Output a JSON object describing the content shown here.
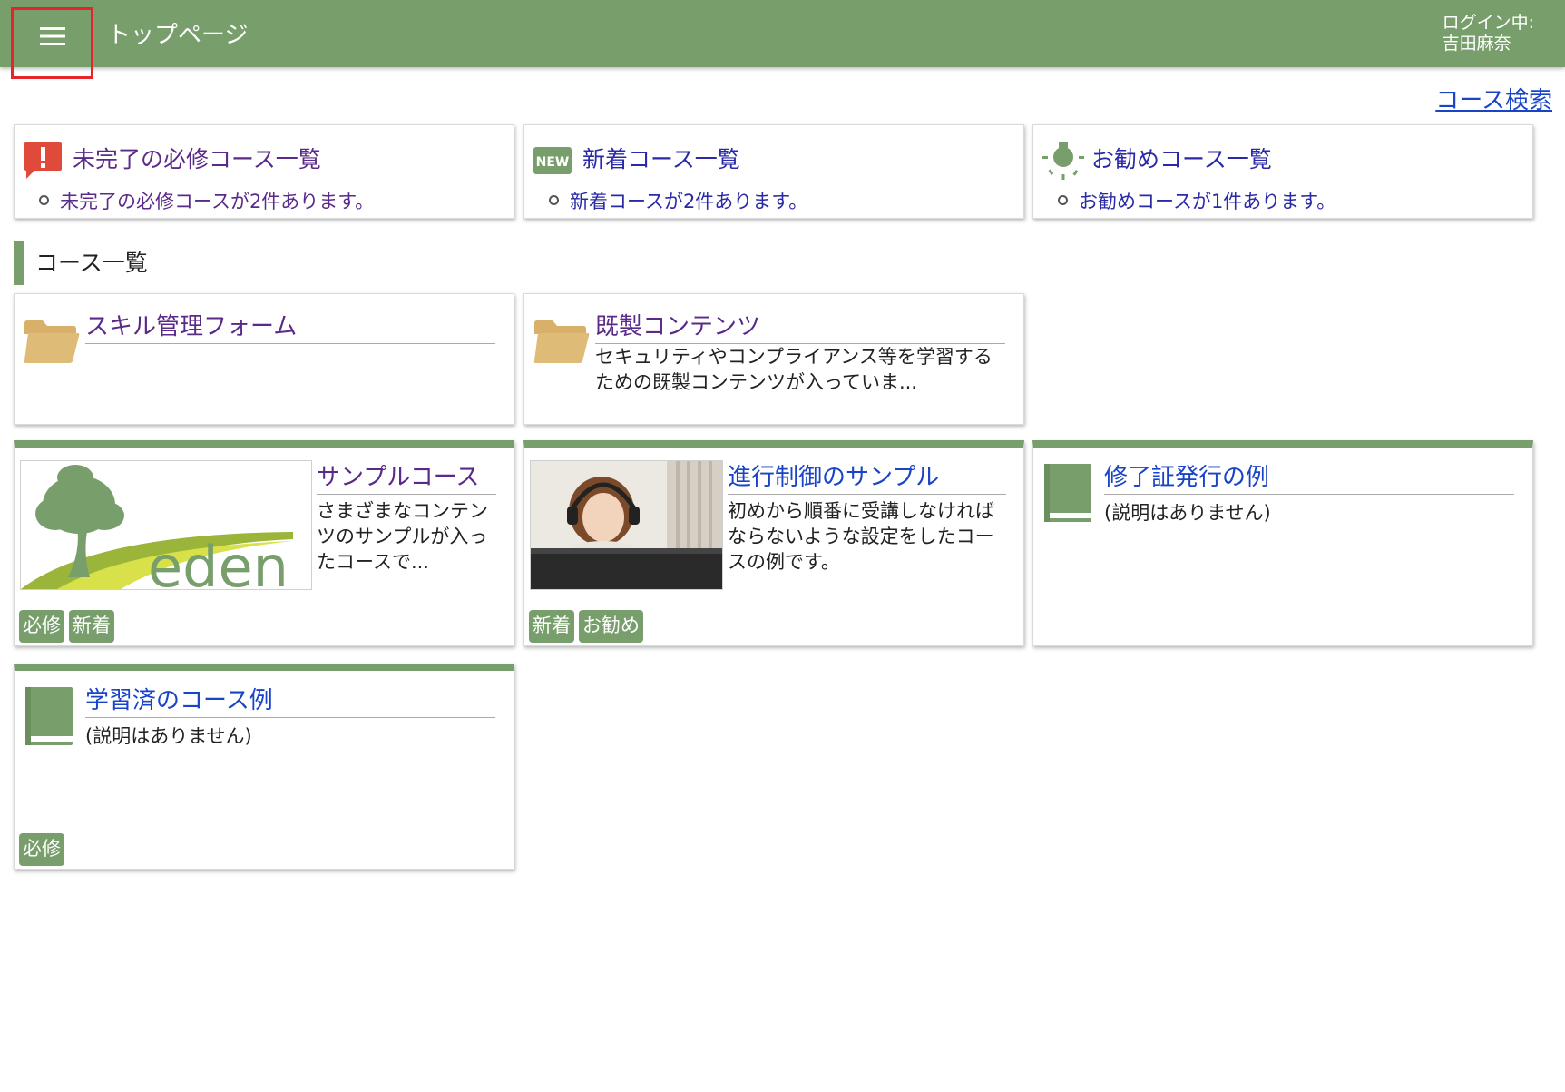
{
  "header": {
    "page_title": "トップページ",
    "login_label": "ログイン中:",
    "user_name": "吉田麻奈",
    "menu_icon": "hamburger-icon"
  },
  "course_search_label": "コース検索",
  "summaries": [
    {
      "title": "未完了の必修コース一覧",
      "item": "未完了の必修コースが2件あります。",
      "icon": "alert-icon"
    },
    {
      "title": "新着コース一覧",
      "item": "新着コースが2件あります。",
      "icon": "new-badge-icon"
    },
    {
      "title": "お勧めコース一覧",
      "item": "お勧めコースが1件あります。",
      "icon": "lightbulb-icon"
    }
  ],
  "section_title": "コース一覧",
  "folders": [
    {
      "title": "スキル管理フォーム",
      "description": "",
      "icon": "folder-icon"
    },
    {
      "title": "既製コンテンツ",
      "description": "セキュリティやコンプライアンス等を学習するための既製コンテンツが入っていま...",
      "icon": "folder-icon"
    }
  ],
  "courses": [
    {
      "title": "サンプルコース",
      "description": "さまざまなコンテンツのサンプルが入ったコースで...",
      "thumbnail_text": "eden",
      "tags": [
        "必修",
        "新着"
      ]
    },
    {
      "title": "進行制御のサンプル",
      "description": "初めから順番に受講しなければならないような設定をしたコースの例です。",
      "tags": [
        "新着",
        "お勧め"
      ]
    },
    {
      "title": "修了証発行の例",
      "description": "(説明はありません)",
      "tags": []
    },
    {
      "title": "学習済のコース例",
      "description": "(説明はありません)",
      "tags": [
        "必修"
      ]
    }
  ],
  "colors": {
    "accent": "#789e6c",
    "link": "#1a44c8",
    "visited": "#5a2a8a",
    "alert": "#e04a3a",
    "folder": "#dfbb78"
  }
}
